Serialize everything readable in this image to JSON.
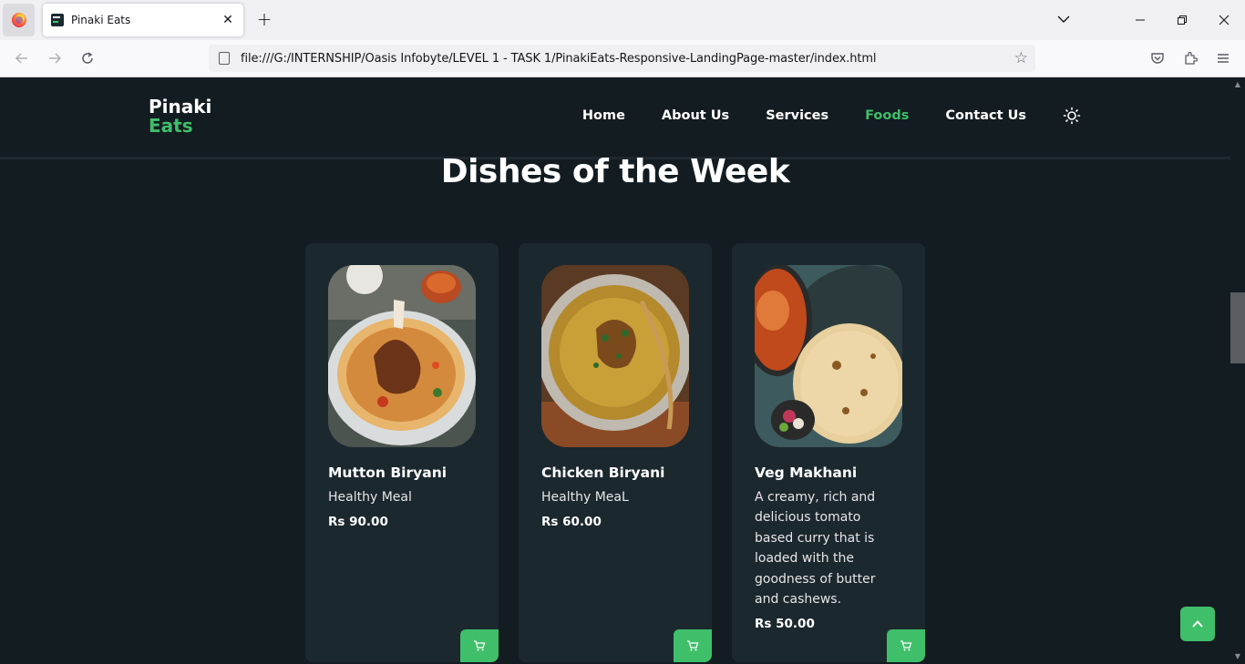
{
  "browser": {
    "tab_title": "Pinaki Eats",
    "url": "file:///G:/INTERNSHIP/Oasis Infobyte/LEVEL 1 - TASK 1/PinakiEats-Responsive-LandingPage-master/index.html",
    "icons": [
      "firefox-icon",
      "close-icon",
      "plus-icon",
      "chevron-down-icon",
      "minimize-icon",
      "restore-icon",
      "close-window-icon",
      "back-icon",
      "forward-icon",
      "reload-icon",
      "page-icon",
      "star-icon",
      "pocket-icon",
      "extensions-icon",
      "menu-icon"
    ]
  },
  "site": {
    "logo_line1": "Pinaki",
    "logo_line2": "Eats",
    "nav": {
      "home": "Home",
      "about": "About Us",
      "services": "Services",
      "foods": "Foods",
      "contact": "Contact Us"
    },
    "section_title": "Dishes of the Week",
    "cards": [
      {
        "name": "Mutton Biryani",
        "desc": "Healthy Meal",
        "price": "Rs 90.00"
      },
      {
        "name": "Chicken Biryani",
        "desc": "Healthy MeaL",
        "price": "Rs 60.00"
      },
      {
        "name": "Veg Makhani",
        "desc": "A creamy, rich and delicious tomato based curry that is loaded with the goodness of butter and cashews.",
        "price": "Rs 50.00"
      }
    ]
  },
  "colors": {
    "background": "#131c21",
    "card": "#1b282e",
    "accent": "#3fbf6a",
    "text": "#ffffff"
  }
}
